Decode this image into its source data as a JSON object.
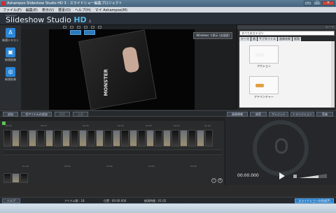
{
  "window": {
    "title": "Ashampoo Slideshow Studio HD 3 - スライドショー編集プロジェクト"
  },
  "menu": [
    "ファイル(F)",
    "編集(E)",
    "表示(V)",
    "要素(O)",
    "ヘルプ(H)",
    "マイ Ashampoo(M)"
  ],
  "brand": {
    "small": "Ashampoo",
    "name": "Slideshow Studio ",
    "hd": "HD",
    "version": "3"
  },
  "sidebar": {
    "items": [
      {
        "label": "新規テキスト",
        "glyph": "A"
      },
      {
        "label": "新規画像",
        "glyph": "▣"
      },
      {
        "label": "新規効果",
        "glyph": "◎"
      }
    ]
  },
  "preview": {
    "badge": "Windows で表示 (全画面)",
    "photo_text": "MONSTER"
  },
  "right_panel": {
    "header": "テーマ",
    "category": "すべてのカテゴリ",
    "tabs": [
      "テーマ",
      "曲",
      "サブタイトル",
      "画像効果",
      "経過"
    ],
    "items": [
      {
        "label": "アクション"
      },
      {
        "label": "アドベンチャー"
      }
    ]
  },
  "actions": {
    "add": "追加",
    "add_items": "空アイテムの追加",
    "delete": "削除",
    "more": "全般",
    "title_info": "画像情報",
    "music": "録音",
    "credits": "クレジット",
    "transition": "トランジション",
    "sound": "音楽"
  },
  "timeline": {
    "ruler_top": [
      "00:00",
      "00:10",
      "00:20",
      "00:30",
      "00:40",
      "00:50",
      "01:00"
    ],
    "ruler_bottom": [
      "00:00",
      "01:00",
      "02:00",
      "03:00",
      "04:00",
      "05:00"
    ]
  },
  "player": {
    "time": "00:00.000",
    "volume": 0.7
  },
  "bottom": {
    "help": "ヘルプ",
    "items_count": "アイテム数 : 18",
    "position": "位置 : 00:00.000",
    "total_length": "総演時間 : 01:02",
    "create": "スライドショーの作成(P)"
  }
}
